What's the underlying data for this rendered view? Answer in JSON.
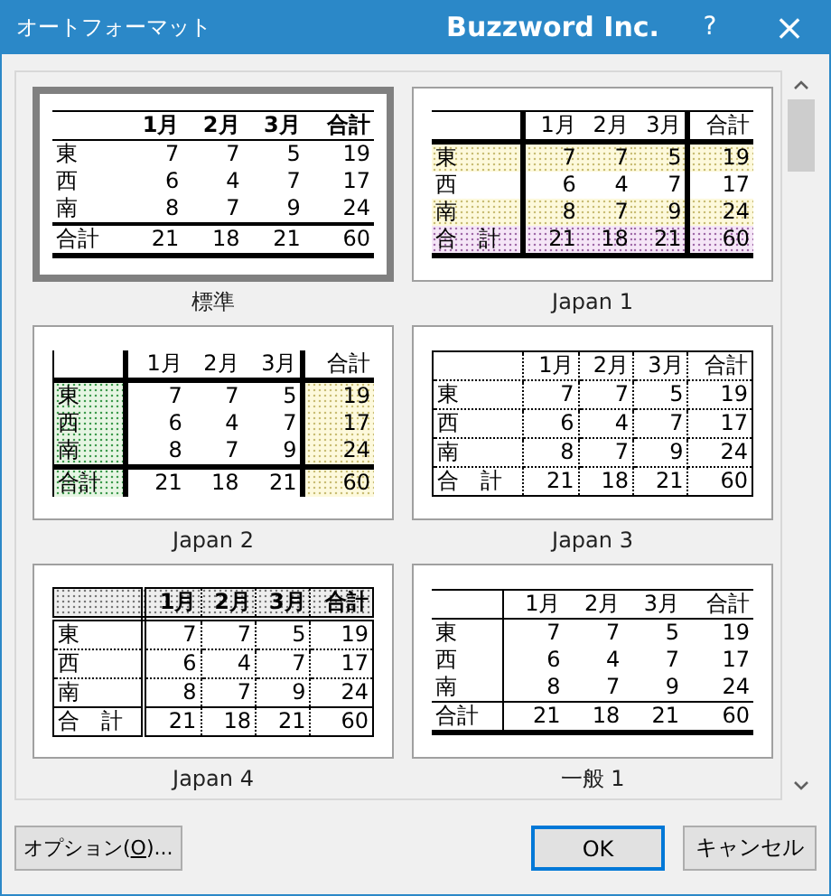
{
  "window": {
    "title": "オートフォーマット",
    "brand": "Buzzword Inc.",
    "help": "?",
    "close": "×"
  },
  "formats": [
    {
      "name": "標準",
      "kind": "standard",
      "selected": true,
      "header": [
        "1月",
        "2月",
        "3月",
        "合計"
      ],
      "rows": [
        {
          "label": "東",
          "values": [
            "7",
            "7",
            "5",
            "19"
          ]
        },
        {
          "label": "西",
          "values": [
            "6",
            "4",
            "7",
            "17"
          ]
        },
        {
          "label": "南",
          "values": [
            "8",
            "7",
            "9",
            "24"
          ]
        },
        {
          "label": "合計",
          "values": [
            "21",
            "18",
            "21",
            "60"
          ]
        }
      ]
    },
    {
      "name": "Japan 1",
      "kind": "japan1",
      "selected": false,
      "header": [
        "1月",
        "2月",
        "3月",
        "合計"
      ],
      "rows": [
        {
          "label": "東",
          "values": [
            "7",
            "7",
            "5",
            "19"
          ]
        },
        {
          "label": "西",
          "values": [
            "6",
            "4",
            "7",
            "17"
          ]
        },
        {
          "label": "南",
          "values": [
            "8",
            "7",
            "9",
            "24"
          ]
        },
        {
          "label": "合　計",
          "values": [
            "21",
            "18",
            "21",
            "60"
          ]
        }
      ]
    },
    {
      "name": "Japan 2",
      "kind": "japan2",
      "selected": false,
      "header": [
        "1月",
        "2月",
        "3月",
        "合計"
      ],
      "rows": [
        {
          "label": "東",
          "values": [
            "7",
            "7",
            "5",
            "19"
          ]
        },
        {
          "label": "西",
          "values": [
            "6",
            "4",
            "7",
            "17"
          ]
        },
        {
          "label": "南",
          "values": [
            "8",
            "7",
            "9",
            "24"
          ]
        },
        {
          "label": "合計",
          "values": [
            "21",
            "18",
            "21",
            "60"
          ]
        }
      ]
    },
    {
      "name": "Japan 3",
      "kind": "japan3",
      "selected": false,
      "header": [
        "1月",
        "2月",
        "3月",
        "合計"
      ],
      "rows": [
        {
          "label": "東",
          "values": [
            "7",
            "7",
            "5",
            "19"
          ]
        },
        {
          "label": "西",
          "values": [
            "6",
            "4",
            "7",
            "17"
          ]
        },
        {
          "label": "南",
          "values": [
            "8",
            "7",
            "9",
            "24"
          ]
        },
        {
          "label": "合　計",
          "values": [
            "21",
            "18",
            "21",
            "60"
          ]
        }
      ]
    },
    {
      "name": "Japan 4",
      "kind": "japan4",
      "selected": false,
      "header": [
        "1月",
        "2月",
        "3月",
        "合計"
      ],
      "rows": [
        {
          "label": "東",
          "values": [
            "7",
            "7",
            "5",
            "19"
          ]
        },
        {
          "label": "西",
          "values": [
            "6",
            "4",
            "7",
            "17"
          ]
        },
        {
          "label": "南",
          "values": [
            "8",
            "7",
            "9",
            "24"
          ]
        },
        {
          "label": "合　計",
          "values": [
            "21",
            "18",
            "21",
            "60"
          ]
        }
      ]
    },
    {
      "name": "一般 1",
      "kind": "general1",
      "selected": false,
      "header": [
        "1月",
        "2月",
        "3月",
        "合計"
      ],
      "rows": [
        {
          "label": "東",
          "values": [
            "7",
            "7",
            "5",
            "19"
          ]
        },
        {
          "label": "西",
          "values": [
            "6",
            "4",
            "7",
            "17"
          ]
        },
        {
          "label": "南",
          "values": [
            "8",
            "7",
            "9",
            "24"
          ]
        },
        {
          "label": "合計",
          "values": [
            "21",
            "18",
            "21",
            "60"
          ]
        }
      ]
    }
  ],
  "buttons": [
    {
      "kind": "options",
      "before": "オプション(",
      "access_key": "O",
      "after": ")...",
      "default": false
    },
    {
      "kind": "ok",
      "before": "OK",
      "default": true
    },
    {
      "kind": "cancel",
      "before": "キャンセル",
      "default": false
    }
  ]
}
